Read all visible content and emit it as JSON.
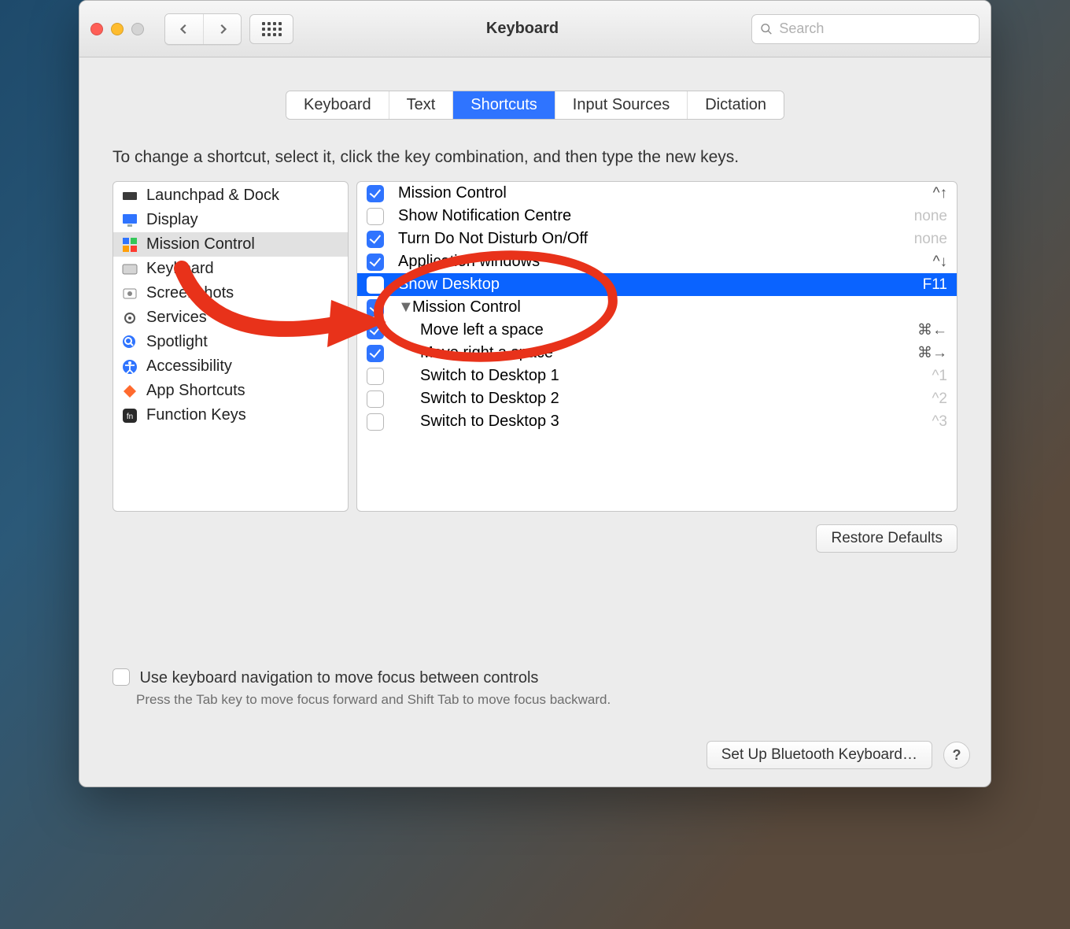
{
  "window": {
    "title": "Keyboard"
  },
  "search": {
    "placeholder": "Search",
    "value": ""
  },
  "tabs": [
    "Keyboard",
    "Text",
    "Shortcuts",
    "Input Sources",
    "Dictation"
  ],
  "tabs_active_index": 2,
  "instruction": "To change a shortcut, select it, click the key combination, and then type the new keys.",
  "categories": [
    {
      "label": "Launchpad & Dock",
      "icon": "launchpad-icon",
      "selected": false
    },
    {
      "label": "Display",
      "icon": "display-icon",
      "selected": false
    },
    {
      "label": "Mission Control",
      "icon": "mission-control-icon",
      "selected": true
    },
    {
      "label": "Keyboard",
      "icon": "keyboard-icon",
      "selected": false
    },
    {
      "label": "Screenshots",
      "icon": "screenshot-icon",
      "selected": false
    },
    {
      "label": "Services",
      "icon": "gear-icon",
      "selected": false
    },
    {
      "label": "Spotlight",
      "icon": "search-icon",
      "selected": false
    },
    {
      "label": "Accessibility",
      "icon": "accessibility-icon",
      "selected": false
    },
    {
      "label": "App Shortcuts",
      "icon": "apps-icon",
      "selected": false
    },
    {
      "label": "Function Keys",
      "icon": "fn-icon",
      "selected": false
    }
  ],
  "shortcuts": [
    {
      "checked": true,
      "label": "Mission Control",
      "key": "^↑",
      "indent": 0
    },
    {
      "checked": false,
      "label": "Show Notification Centre",
      "key": "none",
      "key_dim": true,
      "indent": 0
    },
    {
      "checked": true,
      "label": "Turn Do Not Disturb On/Off",
      "key": "none",
      "key_dim": true,
      "indent": 0
    },
    {
      "checked": true,
      "label": "Application windows",
      "key": "^↓",
      "indent": 0
    },
    {
      "checked": false,
      "label": "Show Desktop",
      "key": "F11",
      "indent": 0,
      "selected": true
    },
    {
      "checked": true,
      "label": "Mission Control",
      "indent": 0,
      "group": true,
      "disclosure": "▼"
    },
    {
      "checked": true,
      "label": "Move left a space",
      "key": "⌘←",
      "indent": 1
    },
    {
      "checked": true,
      "label": "Move right a space",
      "key": "⌘→",
      "indent": 1
    },
    {
      "checked": false,
      "label": "Switch to Desktop 1",
      "key": "^1",
      "key_dim": true,
      "indent": 1
    },
    {
      "checked": false,
      "label": "Switch to Desktop 2",
      "key": "^2",
      "key_dim": true,
      "indent": 1
    },
    {
      "checked": false,
      "label": "Switch to Desktop 3",
      "key": "^3",
      "key_dim": true,
      "indent": 1
    }
  ],
  "buttons": {
    "restore_defaults": "Restore Defaults",
    "setup_bluetooth": "Set Up Bluetooth Keyboard…",
    "help": "?"
  },
  "footer": {
    "checkbox_label": "Use keyboard navigation to move focus between controls",
    "hint": "Press the Tab key to move focus forward and Shift Tab to move focus backward."
  }
}
